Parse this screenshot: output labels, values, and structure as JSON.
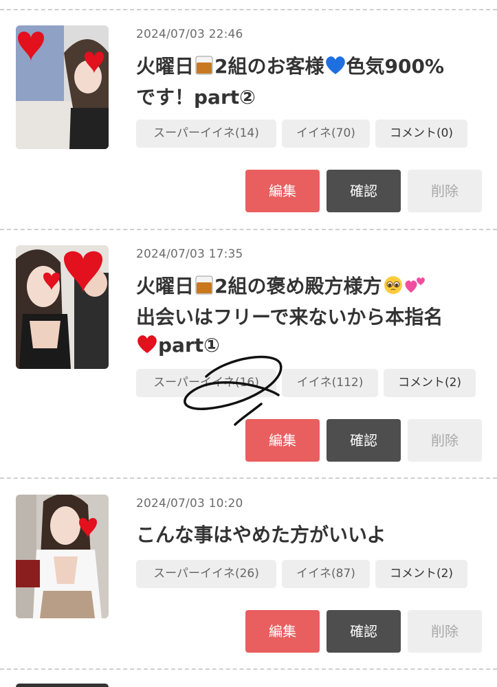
{
  "posts": [
    {
      "date": "2024/07/03 22:46",
      "title_a": "火曜日",
      "title_b": "2組のお客様",
      "title_c": "色気900%",
      "title_line2": "です！part②",
      "chips": {
        "super": "スーパーイイネ(14)",
        "like": "イイネ(70)",
        "comment": "コメント(0)"
      },
      "actions": {
        "edit": "編集",
        "confirm": "確認",
        "delete": "削除"
      }
    },
    {
      "date": "2024/07/03 17:35",
      "title_a": "火曜日",
      "title_b": "2組の褒め殿方様方",
      "title_line2": "出会いはフリーで来ないから本指名",
      "title_line3": "part①",
      "chips": {
        "super": "スーパーイイネ(16)",
        "like": "イイネ(112)",
        "comment": "コメント(2)"
      },
      "actions": {
        "edit": "編集",
        "confirm": "確認",
        "delete": "削除"
      }
    },
    {
      "date": "2024/07/03 10:20",
      "title": "こんな事はやめた方がいいよ",
      "chips": {
        "super": "スーパーイイネ(26)",
        "like": "イイネ(87)",
        "comment": "コメント(2)"
      },
      "actions": {
        "edit": "編集",
        "confirm": "確認",
        "delete": "削除"
      }
    }
  ],
  "colors": {
    "edit": "#e95f5f",
    "confirm": "#4e4e4e",
    "delete_bg": "#eeeeee",
    "chip_bg": "#eeeeee"
  }
}
